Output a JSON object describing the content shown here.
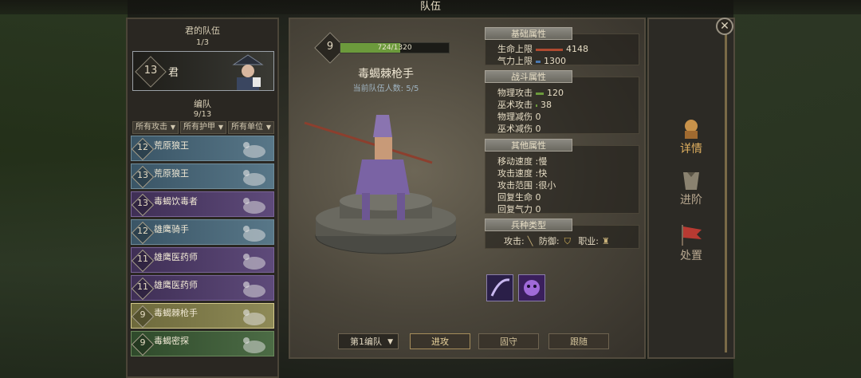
{
  "window_title": "队伍",
  "left_panel": {
    "party_title": "君的队伍",
    "party_count": "1/3",
    "leader": {
      "level": "13",
      "name": "君"
    },
    "squad_title": "编队",
    "squad_count": "9/13",
    "filters": [
      "所有攻击",
      "所有护甲",
      "所有单位"
    ],
    "units": [
      {
        "level": "12",
        "name": "荒原狼王",
        "tint": "blue"
      },
      {
        "level": "13",
        "name": "荒原狼王",
        "tint": "blue"
      },
      {
        "level": "13",
        "name": "毒蝎饮毒者",
        "tint": "purple"
      },
      {
        "level": "12",
        "name": "雄鹰骑手",
        "tint": "blue"
      },
      {
        "level": "11",
        "name": "雄鹰医药师",
        "tint": "purple"
      },
      {
        "level": "11",
        "name": "雄鹰医药师",
        "tint": "purple"
      },
      {
        "level": "9",
        "name": "毒蝎棘枪手",
        "tint": "selected"
      },
      {
        "level": "9",
        "name": "毒蝎密探",
        "tint": "green"
      }
    ]
  },
  "unit_detail": {
    "level": "9",
    "xp_text": "724/1320",
    "xp_progress": 0.548,
    "name": "毒蝎棘枪手",
    "team_count": "当前队伍人数: 5/5"
  },
  "stats": {
    "basic_header": "基础属性",
    "hp_label": "生命上限",
    "hp_value": "4148",
    "qi_label": "气力上限",
    "qi_value": "1300",
    "combat_header": "战斗属性",
    "phys_atk_label": "物理攻击",
    "phys_atk_value": "120",
    "magic_atk_label": "巫术攻击",
    "magic_atk_value": "38",
    "phys_def_label": "物理减伤",
    "phys_def_value": "0",
    "magic_def_label": "巫术减伤",
    "magic_def_value": "0",
    "other_header": "其他属性",
    "move_speed": "移动速度 :慢",
    "atk_speed": "攻击速度 :快",
    "atk_range": "攻击范围 :很小",
    "regen_hp_label": "回复生命",
    "regen_hp_value": "0",
    "regen_qi_label": "回复气力",
    "regen_qi_value": "0",
    "type_header": "兵种类型",
    "attack_label": "攻击:",
    "defense_label": "防御:",
    "class_label": "职业:"
  },
  "side_actions": [
    "详情",
    "进阶",
    "处置"
  ],
  "bottom": {
    "formation": "第1编队",
    "attack": "进攻",
    "defend": "固守",
    "follow": "跟随"
  },
  "colors": {
    "accent": "#e0b060",
    "xp_bar": "#6c9a3c"
  }
}
